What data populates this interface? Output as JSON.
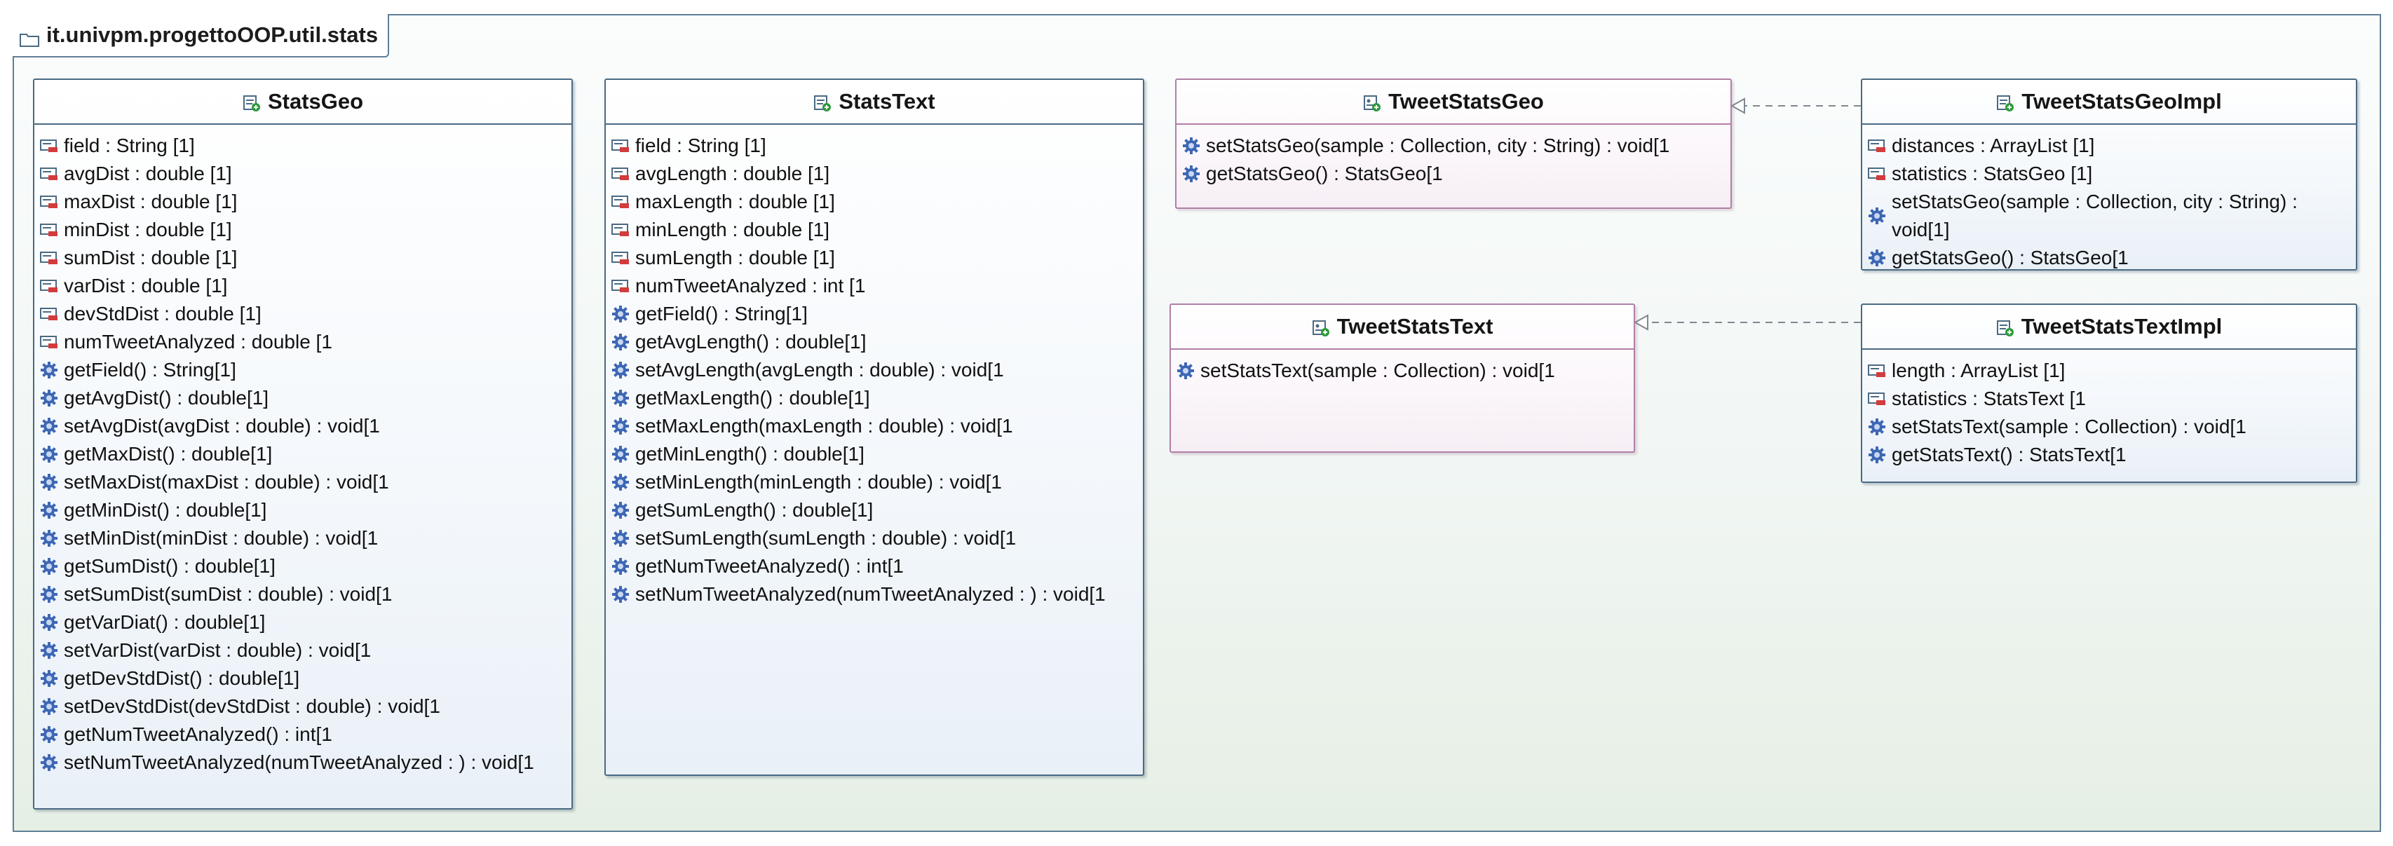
{
  "package": {
    "name": "it.univpm.progettoOOP.util.stats",
    "icon": "package-folder-icon"
  },
  "colors": {
    "package_border": "#5f7f96",
    "class_border": "#4a6a83",
    "interface_border": "#b27ea6",
    "field_icon_red": "#d23c3c",
    "method_icon_blue": "#3e67b4"
  },
  "classes": {
    "stats_geo": {
      "name": "StatsGeo",
      "kind": "class",
      "members": [
        {
          "text": "field : String [1]",
          "kind": "field"
        },
        {
          "text": "avgDist : double [1]",
          "kind": "field"
        },
        {
          "text": "maxDist : double [1]",
          "kind": "field"
        },
        {
          "text": "minDist : double [1]",
          "kind": "field"
        },
        {
          "text": "sumDist : double [1]",
          "kind": "field"
        },
        {
          "text": "varDist : double [1]",
          "kind": "field"
        },
        {
          "text": "devStdDist : double [1]",
          "kind": "field"
        },
        {
          "text": "numTweetAnalyzed : double [1",
          "kind": "field"
        },
        {
          "text": "getField() : String[1]",
          "kind": "method"
        },
        {
          "text": "getAvgDist() : double[1]",
          "kind": "method"
        },
        {
          "text": "setAvgDist(avgDist : double) : void[1",
          "kind": "method"
        },
        {
          "text": "getMaxDist() : double[1]",
          "kind": "method"
        },
        {
          "text": "setMaxDist(maxDist : double) : void[1",
          "kind": "method"
        },
        {
          "text": "getMinDist() : double[1]",
          "kind": "method"
        },
        {
          "text": "setMinDist(minDist : double) : void[1",
          "kind": "method"
        },
        {
          "text": "getSumDist() : double[1]",
          "kind": "method"
        },
        {
          "text": "setSumDist(sumDist : double) : void[1",
          "kind": "method"
        },
        {
          "text": "getVarDiat() : double[1]",
          "kind": "method"
        },
        {
          "text": "setVarDist(varDist : double) : void[1",
          "kind": "method"
        },
        {
          "text": "getDevStdDist() : double[1]",
          "kind": "method"
        },
        {
          "text": "setDevStdDist(devStdDist : double) : void[1",
          "kind": "method"
        },
        {
          "text": "getNumTweetAnalyzed() : int[1",
          "kind": "method"
        },
        {
          "text": "setNumTweetAnalyzed(numTweetAnalyzed : ) : void[1",
          "kind": "method"
        }
      ]
    },
    "stats_text": {
      "name": "StatsText",
      "kind": "class",
      "members": [
        {
          "text": "field : String [1]",
          "kind": "field"
        },
        {
          "text": "avgLength : double [1]",
          "kind": "field"
        },
        {
          "text": "maxLength : double [1]",
          "kind": "field"
        },
        {
          "text": "minLength : double [1]",
          "kind": "field"
        },
        {
          "text": "sumLength : double [1]",
          "kind": "field"
        },
        {
          "text": "numTweetAnalyzed : int [1",
          "kind": "field"
        },
        {
          "text": "getField() : String[1]",
          "kind": "method"
        },
        {
          "text": "getAvgLength() : double[1]",
          "kind": "method"
        },
        {
          "text": "setAvgLength(avgLength : double) : void[1",
          "kind": "method"
        },
        {
          "text": "getMaxLength() : double[1]",
          "kind": "method"
        },
        {
          "text": "setMaxLength(maxLength : double) : void[1",
          "kind": "method"
        },
        {
          "text": "getMinLength() : double[1]",
          "kind": "method"
        },
        {
          "text": "setMinLength(minLength : double) : void[1",
          "kind": "method"
        },
        {
          "text": "getSumLength() : double[1]",
          "kind": "method"
        },
        {
          "text": "setSumLength(sumLength : double) : void[1",
          "kind": "method"
        },
        {
          "text": "getNumTweetAnalyzed() : int[1",
          "kind": "method"
        },
        {
          "text": "setNumTweetAnalyzed(numTweetAnalyzed : ) : void[1",
          "kind": "method"
        }
      ]
    },
    "tweet_stats_geo": {
      "name": "TweetStatsGeo",
      "kind": "interface",
      "members": [
        {
          "text": "setStatsGeo(sample : Collection, city : String) : void[1",
          "kind": "method"
        },
        {
          "text": "getStatsGeo() : StatsGeo[1",
          "kind": "method"
        }
      ]
    },
    "tweet_stats_text": {
      "name": "TweetStatsText",
      "kind": "interface",
      "members": [
        {
          "text": "setStatsText(sample : Collection) : void[1",
          "kind": "method"
        }
      ]
    },
    "tweet_stats_geo_impl": {
      "name": "TweetStatsGeoImpl",
      "kind": "class",
      "members": [
        {
          "text": "distances : ArrayList [1]",
          "kind": "field"
        },
        {
          "text": "statistics : StatsGeo [1]",
          "kind": "field"
        },
        {
          "text": "setStatsGeo(sample : Collection, city : String) : void[1]",
          "kind": "method",
          "wrapped": true
        },
        {
          "text": "getStatsGeo() : StatsGeo[1",
          "kind": "method"
        }
      ]
    },
    "tweet_stats_text_impl": {
      "name": "TweetStatsTextImpl",
      "kind": "class",
      "members": [
        {
          "text": "length : ArrayList [1]",
          "kind": "field"
        },
        {
          "text": "statistics : StatsText [1",
          "kind": "field"
        },
        {
          "text": "setStatsText(sample : Collection) : void[1",
          "kind": "method"
        },
        {
          "text": "getStatsText() : StatsText[1",
          "kind": "method"
        }
      ]
    }
  },
  "relationships": [
    {
      "type": "realization",
      "from": "TweetStatsGeoImpl",
      "to": "TweetStatsGeo"
    },
    {
      "type": "realization",
      "from": "TweetStatsTextImpl",
      "to": "TweetStatsText"
    }
  ]
}
